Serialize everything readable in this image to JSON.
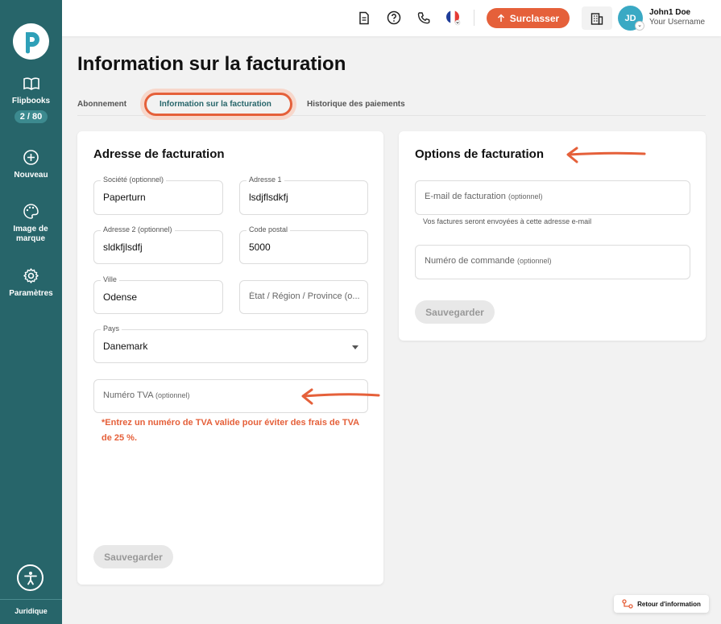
{
  "sidebar": {
    "items": [
      {
        "label": "Flipbooks",
        "icon": "book-open-icon",
        "count": "2 / 80"
      },
      {
        "label": "Nouveau",
        "icon": "plus-circle-icon"
      },
      {
        "label": "Image de marque",
        "icon": "palette-icon"
      },
      {
        "label": "Paramètres",
        "icon": "gear-icon"
      }
    ],
    "footer_label": "Juridique"
  },
  "topbar": {
    "upgrade_label": "Surclasser",
    "avatar_initials": "JD",
    "user_name": "John1 Doe",
    "user_sub": "Your Username"
  },
  "page": {
    "title": "Information sur la facturation",
    "tabs": [
      {
        "label": "Abonnement",
        "active": false
      },
      {
        "label": "Information sur la facturation",
        "active": true
      },
      {
        "label": "Historique des paiements",
        "active": false
      }
    ]
  },
  "billing_address": {
    "title": "Adresse de facturation",
    "fields": {
      "company": {
        "label": "Société (optionnel)",
        "value": "Paperturn"
      },
      "address1": {
        "label": "Adresse 1",
        "value": "lsdjflsdkfj"
      },
      "address2": {
        "label": "Adresse 2 (optionnel)",
        "value": "sldkfjlsdfj"
      },
      "postal_code": {
        "label": "Code postal",
        "value": "5000"
      },
      "city": {
        "label": "Ville",
        "value": "Odense"
      },
      "state": {
        "placeholder": "État / Région / Province (o..."
      },
      "country": {
        "label": "Pays",
        "value": "Danemark"
      },
      "vat": {
        "placeholder": "Numéro TVA",
        "placeholder_optional": "(optionnel)"
      }
    },
    "vat_warning": "*Entrez un numéro de TVA valide pour éviter des frais de TVA de 25 %.",
    "save_label": "Sauvegarder"
  },
  "billing_options": {
    "title": "Options de facturation",
    "email": {
      "placeholder": "E-mail de facturation",
      "placeholder_optional": "(optionnel)"
    },
    "email_helper": "Vos factures seront envoyées à cette adresse e-mail",
    "order_number": {
      "placeholder": "Numéro de commande",
      "placeholder_optional": "(optionnel)"
    },
    "save_label": "Sauvegarder"
  },
  "feedback": {
    "label": "Retour d'information"
  },
  "colors": {
    "sidebar": "#27656a",
    "accent": "#e5603a",
    "avatar": "#3aa9c4"
  }
}
